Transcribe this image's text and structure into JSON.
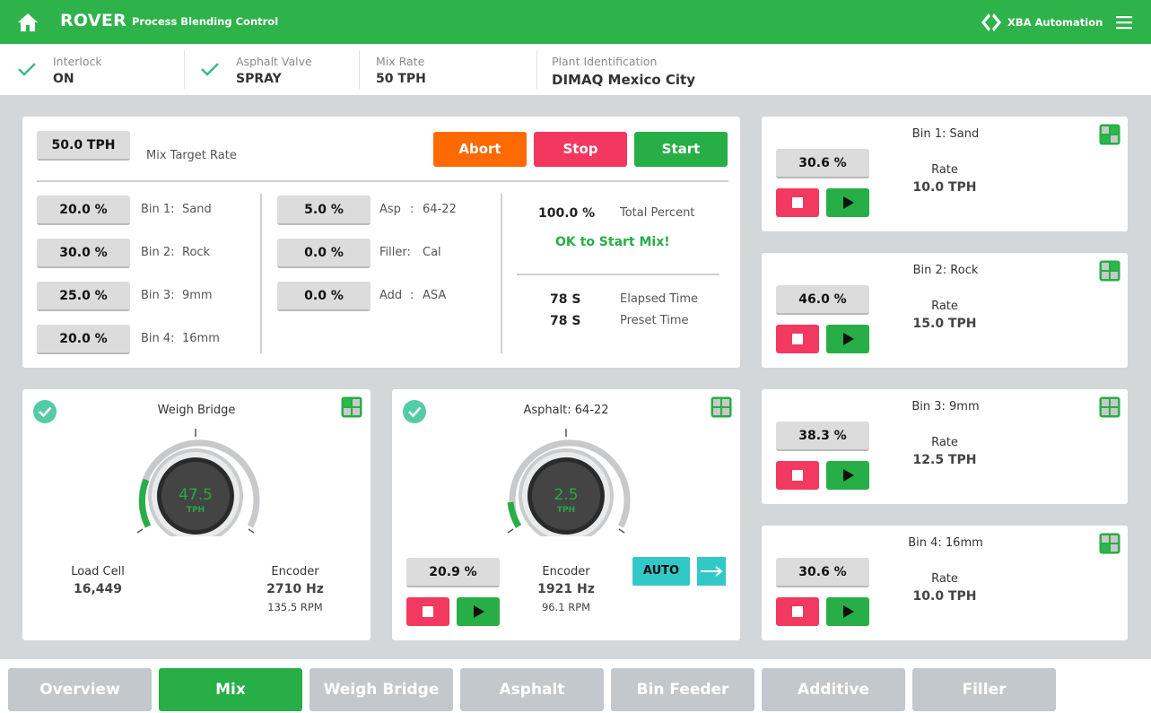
{
  "header": {
    "app_title": "ROVER",
    "app_subtitle": "Process Blending Control",
    "brand_name": "XBA Automation",
    "color": "#2db34a"
  },
  "status": {
    "interlock": {
      "label": "Interlock",
      "value": "ON"
    },
    "asphalt_valve": {
      "label": "Asphalt Valve",
      "value": "SPRAY"
    },
    "mix_rate": {
      "label": "Mix Rate",
      "value": "50 TPH"
    },
    "plant": {
      "label": "Plant Identification",
      "value": "DIMAQ Mexico City"
    }
  },
  "mix": {
    "target_rate_value": "50.0 TPH",
    "target_rate_label": "Mix Target Rate",
    "abort_label": "Abort",
    "stop_label": "Stop",
    "start_label": "Start",
    "bins": [
      {
        "value": "20.0 %",
        "label": "Bin 1:",
        "name": "Sand"
      },
      {
        "value": "30.0 %",
        "label": "Bin 2:",
        "name": "Rock"
      },
      {
        "value": "25.0 %",
        "label": "Bin 3:",
        "name": "9mm"
      },
      {
        "value": "20.0 %",
        "label": "Bin 4:",
        "name": "16mm"
      }
    ],
    "others": [
      {
        "value": "5.0 %",
        "label": "Asp",
        "sep": ":",
        "name": "64-22"
      },
      {
        "value": "0.0 %",
        "label": "Filler:",
        "sep": "",
        "name": "Cal"
      },
      {
        "value": "0.0 %",
        "label": "Add",
        "sep": ":",
        "name": "ASA"
      }
    ],
    "total_percent_value": "100.0 %",
    "total_percent_label": "Total Percent",
    "ok_message": "OK to Start Mix!",
    "elapsed_value": "78 S",
    "elapsed_label": "Elapsed Time",
    "preset_value": "78 S",
    "preset_label": "Preset Time"
  },
  "weigh_bridge": {
    "title": "Weigh Bridge",
    "dial_value": "47.5",
    "dial_unit": "TPH",
    "load_cell_label": "Load Cell",
    "load_cell_value": "16,449",
    "encoder_label": "Encoder",
    "encoder_hz": "2710 Hz",
    "encoder_rpm": "135.5 RPM"
  },
  "asphalt": {
    "title": "Asphalt: 64-22",
    "dial_value": "2.5",
    "dial_unit": "TPH",
    "percent_value": "20.9 %",
    "encoder_label": "Encoder",
    "encoder_hz": "1921 Hz",
    "encoder_rpm": "96.1 RPM",
    "auto_label": "AUTO"
  },
  "bin_cards": [
    {
      "title": "Bin 1: Sand",
      "percent": "30.6 %",
      "rate_label": "Rate",
      "rate_value": "10.0 TPH"
    },
    {
      "title": "Bin 2: Rock",
      "percent": "46.0 %",
      "rate_label": "Rate",
      "rate_value": "15.0 TPH"
    },
    {
      "title": "Bin 3: 9mm",
      "percent": "38.3 %",
      "rate_label": "Rate",
      "rate_value": "12.5 TPH"
    },
    {
      "title": "Bin 4: 16mm",
      "percent": "30.6 %",
      "rate_label": "Rate",
      "rate_value": "10.0 TPH"
    }
  ],
  "tabs": [
    {
      "label": "Overview",
      "active": false
    },
    {
      "label": "Mix",
      "active": true
    },
    {
      "label": "Weigh Bridge",
      "active": false
    },
    {
      "label": "Asphalt",
      "active": false
    },
    {
      "label": "Bin Feeder",
      "active": false
    },
    {
      "label": "Additive",
      "active": false
    },
    {
      "label": "Filler",
      "active": false
    }
  ]
}
